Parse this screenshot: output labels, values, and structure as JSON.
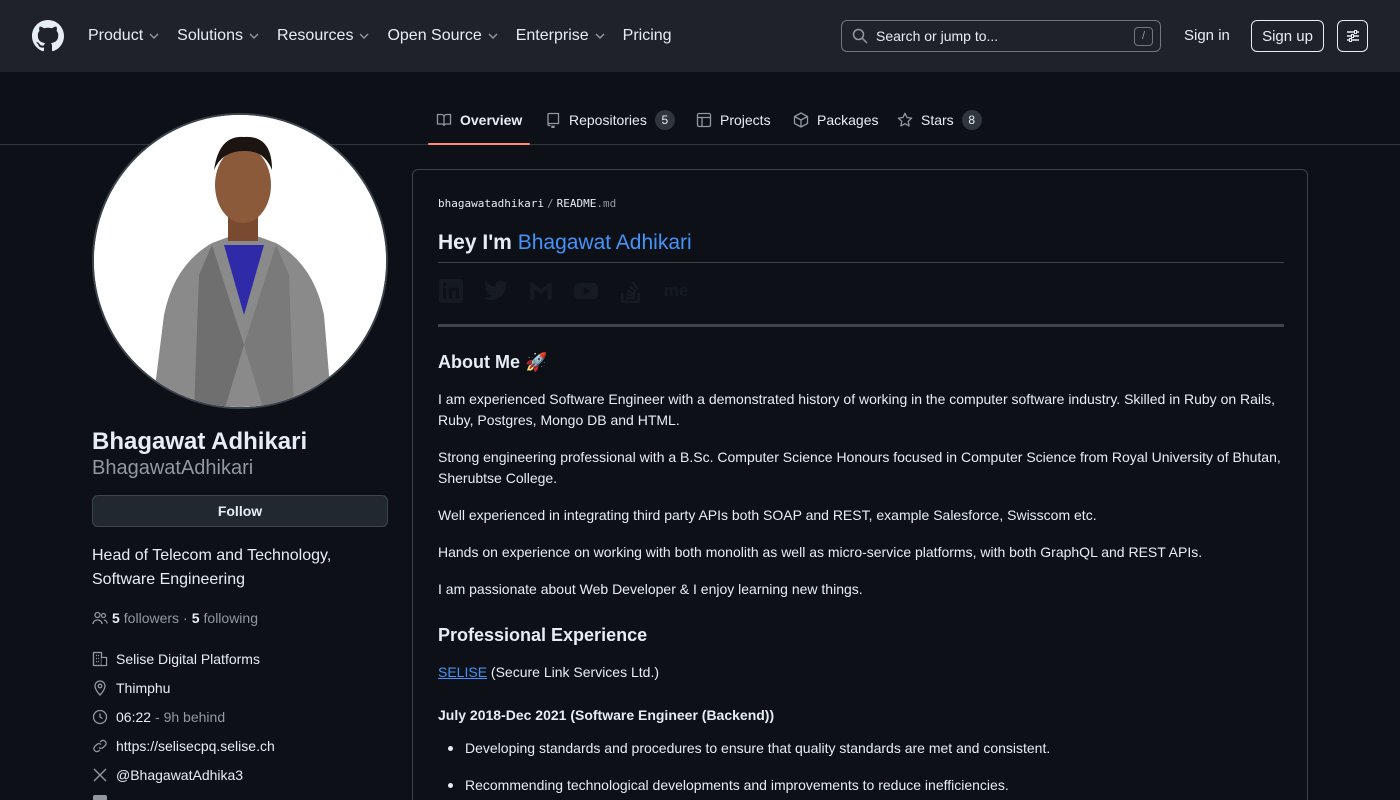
{
  "header": {
    "nav": [
      {
        "label": "Product",
        "has_menu": true
      },
      {
        "label": "Solutions",
        "has_menu": true
      },
      {
        "label": "Resources",
        "has_menu": true
      },
      {
        "label": "Open Source",
        "has_menu": true
      },
      {
        "label": "Enterprise",
        "has_menu": true
      },
      {
        "label": "Pricing",
        "has_menu": false
      }
    ],
    "search_placeholder": "Search or jump to...",
    "search_shortcut": "/",
    "sign_in": "Sign in",
    "sign_up": "Sign up"
  },
  "tabs": [
    {
      "label": "Overview",
      "icon": "book-icon",
      "active": true
    },
    {
      "label": "Repositories",
      "icon": "repo-icon",
      "count": "5"
    },
    {
      "label": "Projects",
      "icon": "table-icon"
    },
    {
      "label": "Packages",
      "icon": "package-icon"
    },
    {
      "label": "Stars",
      "icon": "star-icon",
      "count": "8"
    }
  ],
  "profile": {
    "name": "Bhagawat Adhikari",
    "login": "BhagawatAdhikari",
    "follow": "Follow",
    "bio": "Head of Telecom and Technology, Software Engineering",
    "followers_count": "5",
    "followers_label": "followers",
    "following_count": "5",
    "following_label": "following",
    "separator": "·",
    "company": "Selise Digital Platforms",
    "location": "Thimphu",
    "time": "06:22",
    "time_note": "- 9h behind",
    "website": "https://selisecpq.selise.ch",
    "twitter": "@BhagawatAdhika3"
  },
  "readme": {
    "crumb_user": "bhagawatadhikari",
    "crumb_sep": "/",
    "crumb_file": "README",
    "crumb_ext": ".md",
    "hey_prefix": "Hey I'm",
    "hey_name": "Bhagawat Adhikari",
    "social_me": "me",
    "about_title": "About Me 🚀",
    "about_p1": "I am experienced Software Engineer with a demonstrated history of working in the computer software industry. Skilled in Ruby on Rails, Ruby, Postgres, Mongo DB and HTML.",
    "about_p2": "Strong engineering professional with a B.Sc. Computer Science Honours focused in Computer Science from Royal University of Bhutan, Sherubtse College.",
    "about_p3": "Well experienced in integrating third party APIs both SOAP and REST, example Salesforce, Swisscom etc.",
    "about_p4": "Hands on experience on working with both monolith as well as micro-service platforms, with both GraphQL and REST APIs.",
    "about_p5": "I am passionate about Web Developer & I enjoy learning new things.",
    "exp_title": "Professional Experience",
    "exp_company_link": "SELISE",
    "exp_company_rest": " (Secure Link Services Ltd.)",
    "exp_period": "July 2018-Dec 2021 (Software Engineer (Backend))",
    "exp_bullets": [
      "Developing standards and procedures to ensure that quality standards are met and consistent.",
      "Recommending technological developments and improvements to reduce inefficiencies."
    ]
  },
  "colors": {
    "accent_link": "#4493f8",
    "tab_underline": "#fd8c73",
    "header_bg": "#1f2329",
    "page_bg": "#0d1117"
  }
}
